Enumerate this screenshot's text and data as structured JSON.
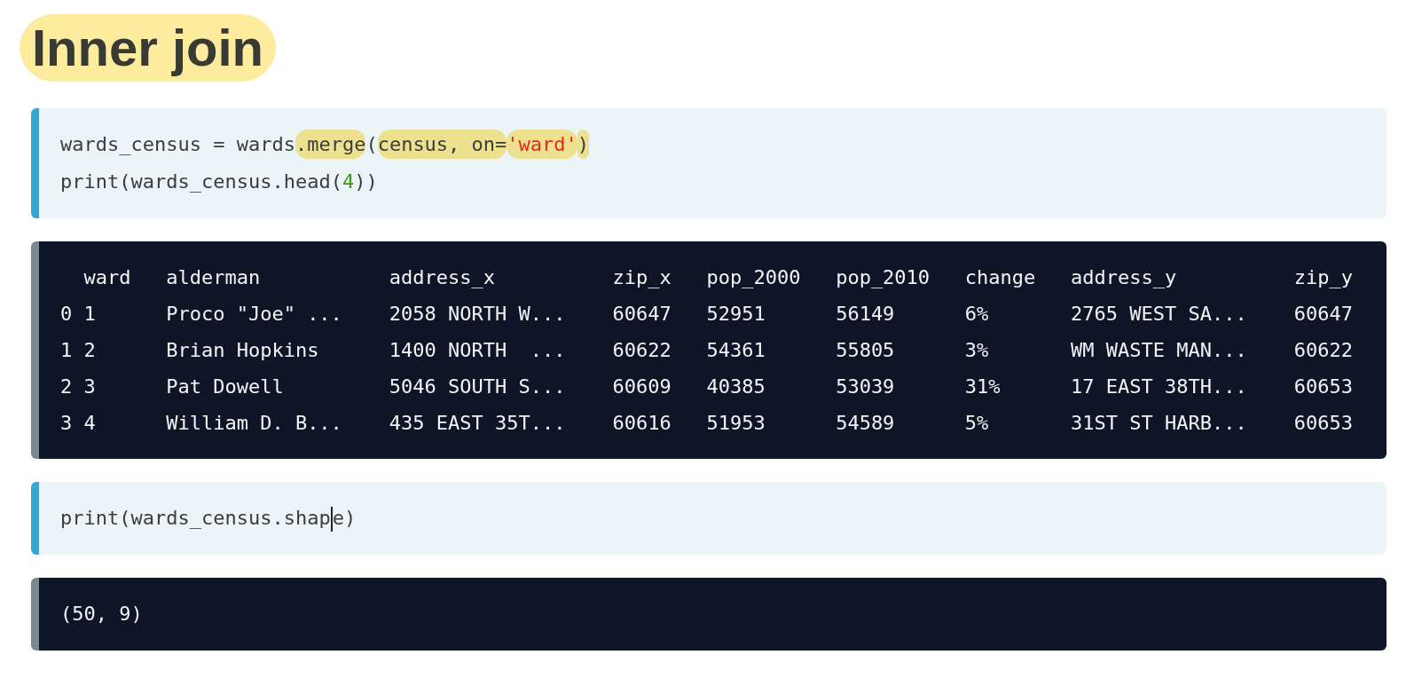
{
  "title": "Inner join",
  "blocks": [
    {
      "kind": "code",
      "lines": [
        [
          {
            "text": "wards_census = wards",
            "kind": "plain",
            "highlighted": false
          },
          {
            "text": ".merge",
            "kind": "plain",
            "highlighted": true
          },
          {
            "text": "(",
            "kind": "plain",
            "highlighted": false
          },
          {
            "text": "census, on=",
            "kind": "plain",
            "highlighted": true
          },
          {
            "text": "'ward'",
            "kind": "string",
            "highlighted": true
          },
          {
            "text": ")",
            "kind": "plain",
            "highlighted": true
          }
        ],
        [
          {
            "text": "print(wards_census.head(",
            "kind": "plain",
            "highlighted": false
          },
          {
            "text": "4",
            "kind": "number",
            "highlighted": false
          },
          {
            "text": "))",
            "kind": "plain",
            "highlighted": false
          }
        ]
      ]
    },
    {
      "kind": "table",
      "columns": [
        "ward",
        "alderman",
        "address_x",
        "zip_x",
        "pop_2000",
        "pop_2010",
        "change",
        "address_y",
        "zip_y"
      ],
      "rows": [
        {
          "index": "0",
          "cells": [
            "1",
            "Proco \"Joe\" ...",
            "2058 NORTH W...",
            "60647",
            "52951",
            "56149",
            "6%",
            "2765 WEST SA...",
            "60647"
          ]
        },
        {
          "index": "1",
          "cells": [
            "2",
            "Brian Hopkins",
            "1400 NORTH  ...",
            "60622",
            "54361",
            "55805",
            "3%",
            "WM WASTE MAN...",
            "60622"
          ]
        },
        {
          "index": "2",
          "cells": [
            "3",
            "Pat Dowell",
            "5046 SOUTH S...",
            "60609",
            "40385",
            "53039",
            "31%",
            "17 EAST 38TH...",
            "60653"
          ]
        },
        {
          "index": "3",
          "cells": [
            "4",
            "William D. B...",
            "435 EAST 35T...",
            "60616",
            "51953",
            "54589",
            "5%",
            "31ST ST HARB...",
            "60653"
          ]
        }
      ]
    },
    {
      "kind": "code",
      "lines": [
        [
          {
            "text": "print(wards_census.shap",
            "kind": "plain",
            "highlighted": false
          },
          {
            "kind": "cursor"
          },
          {
            "text": "e)",
            "kind": "plain",
            "highlighted": false
          }
        ]
      ]
    },
    {
      "kind": "output",
      "lines": [
        "(50, 9)"
      ]
    }
  ]
}
